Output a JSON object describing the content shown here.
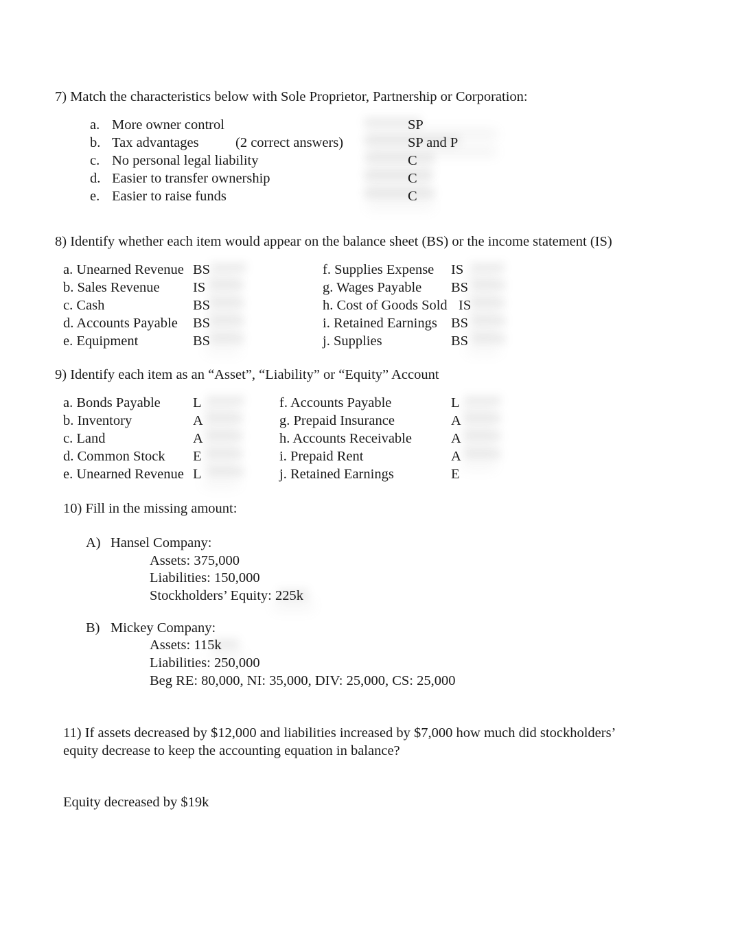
{
  "document": {
    "type": "accounting-worksheet-answer-key",
    "background_color": "#ffffff",
    "text_color": "#1a1a1a"
  },
  "q7": {
    "heading": "7) Match the characteristics below with Sole Proprietor, Partnership or Corporation:",
    "note": "(2 correct answers)",
    "items": [
      {
        "marker": "a.",
        "label": "More owner control",
        "answer": "SP"
      },
      {
        "marker": "b.",
        "label": "Tax advantages",
        "answer": "SP and P"
      },
      {
        "marker": "c.",
        "label": "No personal legal liability",
        "answer": "C"
      },
      {
        "marker": "d.",
        "label": "Easier to transfer ownership",
        "answer": "C"
      },
      {
        "marker": "e.",
        "label": "Easier to raise funds",
        "answer": "C"
      }
    ]
  },
  "q8": {
    "heading": "8) Identify whether each item would appear on the balance sheet (BS) or the income statement (IS)",
    "left": [
      {
        "label": "a. Unearned Revenue",
        "answer": "BS"
      },
      {
        "label": "b. Sales Revenue",
        "answer": "IS"
      },
      {
        "label": "c. Cash",
        "answer": "BS"
      },
      {
        "label": "d. Accounts Payable",
        "answer": "BS"
      },
      {
        "label": "e. Equipment",
        "answer": "BS"
      }
    ],
    "right": [
      {
        "label": "f. Supplies Expense",
        "answer": "IS"
      },
      {
        "label": "g. Wages Payable",
        "answer": "BS"
      },
      {
        "label": "h. Cost of Goods Sold",
        "answer": "IS"
      },
      {
        "label": "i. Retained Earnings",
        "answer": "BS"
      },
      {
        "label": "j. Supplies",
        "answer": "BS"
      }
    ]
  },
  "q9": {
    "heading": "9) Identify each item as an “Asset”, “Liability” or “Equity” Account",
    "left": [
      {
        "label": "a. Bonds Payable",
        "answer": "L"
      },
      {
        "label": "b. Inventory",
        "answer": "A"
      },
      {
        "label": "c. Land",
        "answer": "A"
      },
      {
        "label": "d. Common Stock",
        "answer": "E"
      },
      {
        "label": "e. Unearned Revenue",
        "answer": "L"
      }
    ],
    "right": [
      {
        "label": "f. Accounts Payable",
        "answer": "L"
      },
      {
        "label": "g. Prepaid Insurance",
        "answer": "A"
      },
      {
        "label": "h. Accounts Receivable",
        "answer": "A"
      },
      {
        "label": "i. Prepaid Rent",
        "answer": "A"
      },
      {
        "label": "j. Retained Earnings",
        "answer": "E"
      }
    ]
  },
  "q10": {
    "heading": "10)  Fill in the missing amount:",
    "part_a": {
      "marker": "A)",
      "title": "Hansel Company:",
      "lines": [
        "Assets: 375,000",
        "Liabilities: 150,000",
        "Stockholders’ Equity: 225k"
      ]
    },
    "part_b": {
      "marker": "B)",
      "title": "Mickey Company:",
      "lines": [
        "Assets: 115k",
        "Liabilities: 250,000",
        "Beg RE: 80,000, NI: 35,000, DIV: 25,000, CS: 25,000"
      ]
    }
  },
  "q11": {
    "heading_line1": "11) If assets decreased by $12,000 and liabilities increased by $7,000 how much did stockholders’",
    "heading_line2": "equity decrease to keep the accounting equation in balance?",
    "answer": "Equity decreased by $19k"
  }
}
